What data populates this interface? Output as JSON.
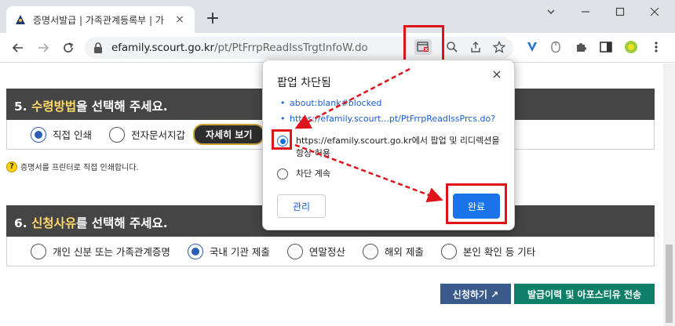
{
  "browser": {
    "tab_title": "증명서발급 | 가족관계등록부 | 가",
    "tab_close": "×",
    "new_tab": "+",
    "url_host": "efamily.scourt.go.kr",
    "url_path": "/pt/PtFrrpReadIssTrgtInfoW.do"
  },
  "section5": {
    "number": "5.",
    "highlight": "수령방법",
    "rest": "을 선택해 주세요.",
    "options": [
      {
        "label": "직접 인쇄",
        "checked": true
      },
      {
        "label": "전자문서지갑",
        "checked": false
      }
    ],
    "detail_button": "자세히 보기",
    "note": "증명서를 프린터로 직접 인쇄합니다."
  },
  "section6": {
    "number": "6.",
    "highlight": "신청사유",
    "rest": "를 선택해 주세요.",
    "options": [
      {
        "label": "개인 신분 또는 가족관계증명",
        "checked": false
      },
      {
        "label": "국내 기관 제출",
        "checked": true
      },
      {
        "label": "연말정산",
        "checked": false
      },
      {
        "label": "해외 제출",
        "checked": false
      },
      {
        "label": "본인 확인 등 기타",
        "checked": false
      }
    ]
  },
  "actions": {
    "apply": "신청하기 ↗",
    "send": "발급이력 및 아포스티유 전송"
  },
  "popup": {
    "title": "팝업 차단됨",
    "close": "×",
    "links": [
      "about:blank#blocked",
      "https://efamily.scourt...pt/PtFrrpReadIssPrcs.do?"
    ],
    "option_allow": "https://efamily.scourt.go.kr에서 팝업 및 리디렉션을 항상 허용",
    "option_block": "차단 계속",
    "manage": "관리",
    "done": "완료"
  },
  "colors": {
    "header_bg": "#454545",
    "highlight": "#ffd86a",
    "apply_btn": "#3b5a8c",
    "send_btn": "#0f7f6a",
    "annotation": "#e0131a",
    "chrome_blue": "#1a73e8"
  }
}
